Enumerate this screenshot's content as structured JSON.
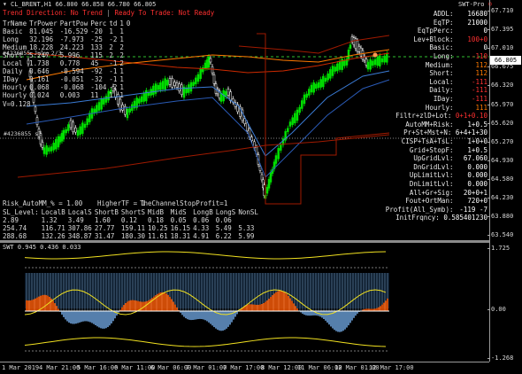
{
  "window": {
    "symbol_line": "CL_BRENT,H1  66.800 66.858 66.780 66.805",
    "chart_icon": "swt-pro-icon",
    "indicator_name": "SWT-Pro",
    "status_line": {
      "trend": "Trend Direction:  No Trend",
      "ready": "Ready To Trade:  Not Ready"
    }
  },
  "tr_table": {
    "header": [
      "TrName",
      "TrPower",
      "PartPow",
      "Perc",
      "td",
      "1",
      "0"
    ],
    "rows": [
      [
        "Basic",
        "81.045",
        "-16.529",
        "-20",
        "1",
        "1",
        ""
      ],
      [
        "Long",
        "32.196",
        "-7.973",
        "-25",
        "-2",
        "1",
        ""
      ],
      [
        "Medium",
        "18.228",
        "24.223",
        "133",
        "2",
        "2",
        ""
      ],
      [
        "Short",
        "5.247",
        "5.996",
        "115",
        "2",
        "2",
        ""
      ],
      [
        "Local",
        "1.738",
        "0.778",
        "45",
        "-1",
        "2",
        ""
      ],
      [
        "Daily",
        "0.646",
        "-0.594",
        "-92",
        "-1",
        "1",
        ""
      ],
      [
        "IDay",
        "0.161",
        "-0.051",
        "-32",
        "-1",
        "1",
        ""
      ],
      [
        "Hourly",
        "0.068",
        "-0.068",
        "-104",
        "-2",
        "1",
        ""
      ],
      [
        "Hourly",
        "0.024",
        "0.003",
        "11",
        "1",
        "1",
        ""
      ]
    ],
    "v_label": "V=0.128",
    "marker1": "#4236855 July 2/3",
    "marker2": "#4236855 sl"
  },
  "risk_table": {
    "title_left": "Risk_AutoMM_% = 1.00",
    "title_mid": "HigherTF = 1",
    "title_right": "TheChannelStopProfit=1",
    "header": [
      "SL_Level:",
      "LocalB",
      "LocalS",
      "ShortB",
      "ShortS",
      "MidB",
      "MidS",
      "LongB",
      "LongS",
      "NonSL"
    ],
    "rows": [
      [
        "2.89",
        "1.32",
        "3.49",
        "1.60",
        "0.12",
        "0.18",
        "0.05",
        "0.06",
        "0.06",
        ""
      ],
      [
        "254.74",
        "116.71",
        "307.86",
        "27.77",
        "159.11",
        "10.25",
        "16.15",
        "4.33",
        "5.49",
        "5.33"
      ],
      [
        "288.68",
        "132.26",
        "348.87",
        "31.47",
        "180.30",
        "11.61",
        "18.31",
        "4.91",
        "6.22",
        "5.99"
      ]
    ]
  },
  "right_panel": [
    {
      "label": "ADDL:",
      "value": "16680",
      "color": "#ffffff"
    },
    {
      "label": "EqTP:",
      "value": "21000",
      "color": "#ffffff"
    },
    {
      "label": "EqTpPerc:",
      "value": "0",
      "color": "#ffffff"
    },
    {
      "label": "Lev+Block:",
      "value": "100+0",
      "color": "#ff3030"
    },
    {
      "label": "Basic:",
      "value": "0",
      "color": "#ffffff"
    },
    {
      "label": "Long:",
      "value": "-110",
      "color": "#ff3030"
    },
    {
      "label": "Medium:",
      "value": "112",
      "color": "#ff7a00"
    },
    {
      "label": "Short:",
      "value": "112",
      "color": "#ff7a00"
    },
    {
      "label": "Local:",
      "value": "-111",
      "color": "#ff3030"
    },
    {
      "label": "Daily:",
      "value": "-111",
      "color": "#ff3030"
    },
    {
      "label": "IDay:",
      "value": "-111",
      "color": "#ff3030"
    },
    {
      "label": "Hourly:",
      "value": "111",
      "color": "#ff7a00"
    },
    {
      "label": "Filtr+zlD+Lot:",
      "value": "0+1+0.10",
      "color": "#ff3030"
    },
    {
      "label": "AutoMM+Risk:",
      "value": "1+0.5",
      "color": "#ffffff"
    },
    {
      "label": "Pr+St+Mst+N:",
      "value": "6+4+1+30",
      "color": "#ffffff"
    },
    {
      "label": "CISP+TsA+TsL:",
      "value": "1+0+0",
      "color": "#ffffff"
    },
    {
      "label": "Grid+StopF:",
      "value": "1+0.5",
      "color": "#ffffff"
    },
    {
      "label": "UpGridLvl:",
      "value": "67.060",
      "color": "#ffffff"
    },
    {
      "label": "DnGridLvl:",
      "value": "0.000",
      "color": "#ffffff"
    },
    {
      "label": "UpLimitLvl:",
      "value": "0.000",
      "color": "#ffffff"
    },
    {
      "label": "DnLimitLvl:",
      "value": "0.000",
      "color": "#ffffff"
    },
    {
      "label": "All+Gr+Sig:",
      "value": "20+0+1",
      "color": "#ffffff"
    },
    {
      "label": "Fout+OrtMan:",
      "value": "720+0",
      "color": "#ffffff"
    },
    {
      "label": "Profit(All_Symb):",
      "value": "-119 -7",
      "color": "#ffffff"
    },
    {
      "label": "InitFrqncy:",
      "value": "0.585401230",
      "color": "#ffffff"
    }
  ],
  "oscillator": {
    "title": "SWT 0.945 0.436 0.033"
  },
  "price_axis": {
    "ticks": [
      "67.710",
      "67.395",
      "67.010",
      "66.675",
      "66.320",
      "65.970",
      "65.620",
      "65.270",
      "64.930",
      "64.580",
      "64.230",
      "63.880",
      "63.540"
    ],
    "current_price": "66.805",
    "osc_ticks": [
      "1.725",
      "0.00",
      "-1.268"
    ]
  },
  "time_axis": {
    "labels": [
      "1 Mar 2019",
      "4 Mar 21:00",
      "5 Mar 16:00",
      "6 Mar 11:00",
      "6 Mar 06:00",
      "7 Mar 01:00",
      "7 Mar 17:00",
      "8 Mar 12:00",
      "11 Mar 06:00",
      "12 Mar 01:00",
      "12 Mar 17:00"
    ]
  },
  "colors": {
    "bull": "#00e000",
    "bear": "#ffffff",
    "ma_blue": "#3a7bd5",
    "ma_red": "#cc2a00",
    "ma_orange": "#ff7a00",
    "osc_orange": "#ff5a00",
    "osc_blue": "#6b9fd8",
    "osc_yellow": "#f0e020",
    "osc_band": "#9fd0ff"
  }
}
